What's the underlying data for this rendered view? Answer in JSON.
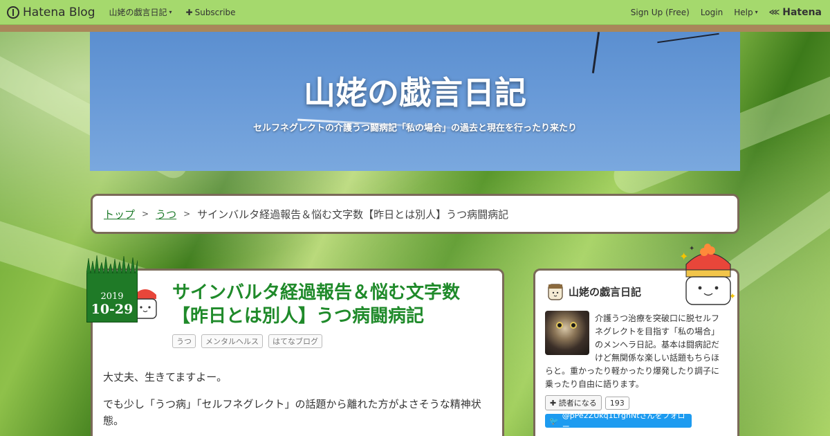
{
  "topbar": {
    "brand": "Hatena Blog",
    "blog_menu": "山姥の戯言日記",
    "subscribe": "Subscribe",
    "signup": "Sign Up (Free)",
    "login": "Login",
    "help": "Help",
    "hatena": "Hatena"
  },
  "header": {
    "title": "山姥の戯言日記",
    "description": "セルフネグレクトの介護うつ闘病記「私の場合」の過去と現在を行ったり来たり"
  },
  "breadcrumb": {
    "items": [
      "トップ",
      "うつ"
    ],
    "current": "サインバルタ経過報告＆悩む文字数【昨日とは別人】うつ病闘病記",
    "separator": ">"
  },
  "entry": {
    "date_year": "2019",
    "date_md": "10-29",
    "title_line1": "サインバルタ経過報告＆悩む文字数",
    "title_line2": "【昨日とは別人】うつ病闘病記",
    "tags": [
      "うつ",
      "メンタルヘルス",
      "はてなブログ"
    ],
    "paragraphs": [
      "大丈夫、生きてますよー。",
      "でも少し「うつ病」「セルフネグレクト」の話題から離れた方がよさそうな精神状",
      "態。"
    ]
  },
  "sidebar": {
    "title": "山姥の戯言日記",
    "description": "介護うつ治療を突破口に脱セルフネグレクトを目指す「私の場合」のメンヘラ日記。基本は闘病記だけど無関係な楽しい話題もちらほらと。重かったり軽かったり爆発したり調子に乗ったり自由に語ります。",
    "follow_label": "読者になる",
    "follower_count": "193",
    "twitter_label": "@pPe2ZUkq1LYgnNtさんをフォロー"
  },
  "colors": {
    "topbar_bg": "#a5d96d",
    "accent_green": "#1f8a2a",
    "card_border": "#7a6a58",
    "twitter_blue": "#1d9bf0"
  },
  "icons": [
    "hatena-logo-icon",
    "plus-icon",
    "chevron-down-icon",
    "twitter-bird-icon",
    "sushi-mascot-icon",
    "cup-mascot-icon"
  ]
}
